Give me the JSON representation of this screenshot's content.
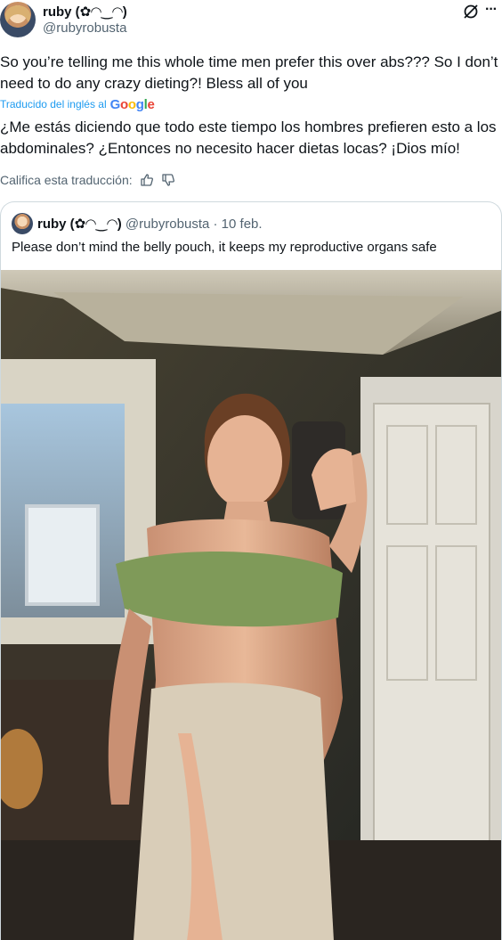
{
  "author": {
    "name": "ruby (✿◠‿◠)",
    "handle": "@rubyrobusta"
  },
  "tweet": {
    "text": "So you’re telling me this whole time men prefer this over abs??? So I don’t need to do any crazy dieting?! Bless all of you",
    "translated_label": "Traducido del inglés al",
    "translation_provider": "Google",
    "translation": "¿Me estás diciendo que todo este tiempo los hombres prefieren esto a los abdominales? ¿Entonces no necesito hacer dietas locas? ¡Dios mío!",
    "rate_label": "Califica esta traducción:"
  },
  "quote": {
    "name": "ruby (✿◠‿◠)",
    "meta": "@rubyrobusta · 10 feb.",
    "text": "Please don’t mind the belly pouch, it keeps my reproductive organs safe"
  },
  "icons": {
    "grok": "grok-icon",
    "more": "more-icon",
    "thumb_up": "thumbs-up-icon",
    "thumb_down": "thumbs-down-icon"
  },
  "colors": {
    "link": "#1d9bf0",
    "secondary": "#536471",
    "border": "#cfd9de"
  }
}
